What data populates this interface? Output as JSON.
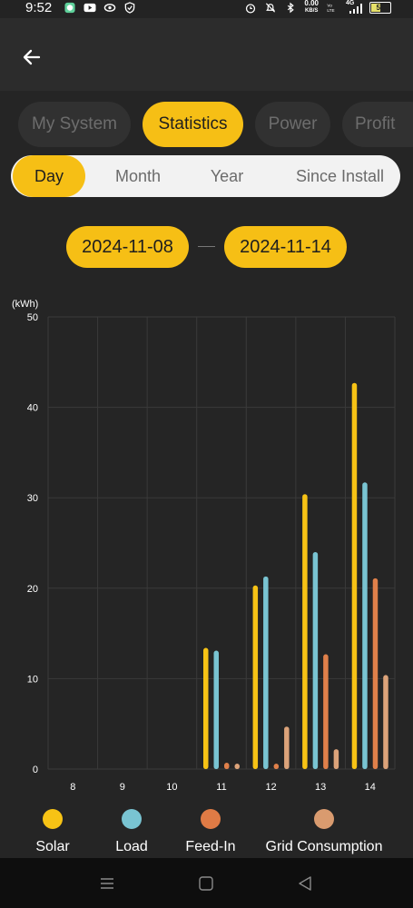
{
  "status_bar": {
    "time": "9:52",
    "net_speed_value": "0.00",
    "net_speed_unit": "KB/S",
    "network": "4G",
    "battery": "51",
    "icons": [
      "whatsapp-icon",
      "youtube-icon",
      "app-icon",
      "shield-icon",
      "alarm-icon",
      "mute-icon",
      "bluetooth-icon",
      "volte-icon",
      "signal-icon",
      "battery-icon"
    ]
  },
  "app_bar": {
    "back_icon": "arrow-left-icon"
  },
  "tabs": [
    {
      "label": "My System",
      "active": false
    },
    {
      "label": "Statistics",
      "active": true
    },
    {
      "label": "Power",
      "active": false
    },
    {
      "label": "Profit",
      "active": false
    }
  ],
  "period": [
    {
      "label": "Day",
      "active": true
    },
    {
      "label": "Month",
      "active": false
    },
    {
      "label": "Year",
      "active": false
    },
    {
      "label": "Since Install",
      "active": false
    }
  ],
  "date_range": {
    "start": "2024-11-08",
    "end": "2024-11-14"
  },
  "chart_data": {
    "type": "bar",
    "unit_label": "(kWh)",
    "categories": [
      "8",
      "9",
      "10",
      "11",
      "12",
      "13",
      "14"
    ],
    "ylim": [
      0,
      50
    ],
    "yticks": [
      0,
      10,
      20,
      30,
      40,
      50
    ],
    "grid": true,
    "legend_position": "bottom",
    "series": [
      {
        "name": "Solar",
        "color": "#f7c315",
        "values": [
          0,
          0,
          0,
          13.4,
          20.3,
          30.4,
          42.7
        ]
      },
      {
        "name": "Load",
        "color": "#79c4d2",
        "values": [
          0,
          0,
          0,
          13.1,
          21.3,
          24.0,
          31.7
        ]
      },
      {
        "name": "Feed-In",
        "color": "#e0804a",
        "values": [
          0,
          0,
          0,
          0.7,
          0.6,
          12.7,
          21.1
        ]
      },
      {
        "name": "Grid Consumption",
        "color": "#dca37a",
        "values": [
          0,
          0,
          0,
          0.6,
          4.7,
          2.2,
          10.4
        ]
      }
    ]
  },
  "legend": [
    {
      "label": "Solar",
      "color": "#f7c315"
    },
    {
      "label": "Load",
      "color": "#79c4d2"
    },
    {
      "label": "Feed-In",
      "color": "#e07b45"
    },
    {
      "label": "Grid Consumption",
      "color": "#d99b6f"
    }
  ],
  "nav_bar": {
    "icons": [
      "menu-icon",
      "home-icon",
      "back-icon"
    ]
  }
}
